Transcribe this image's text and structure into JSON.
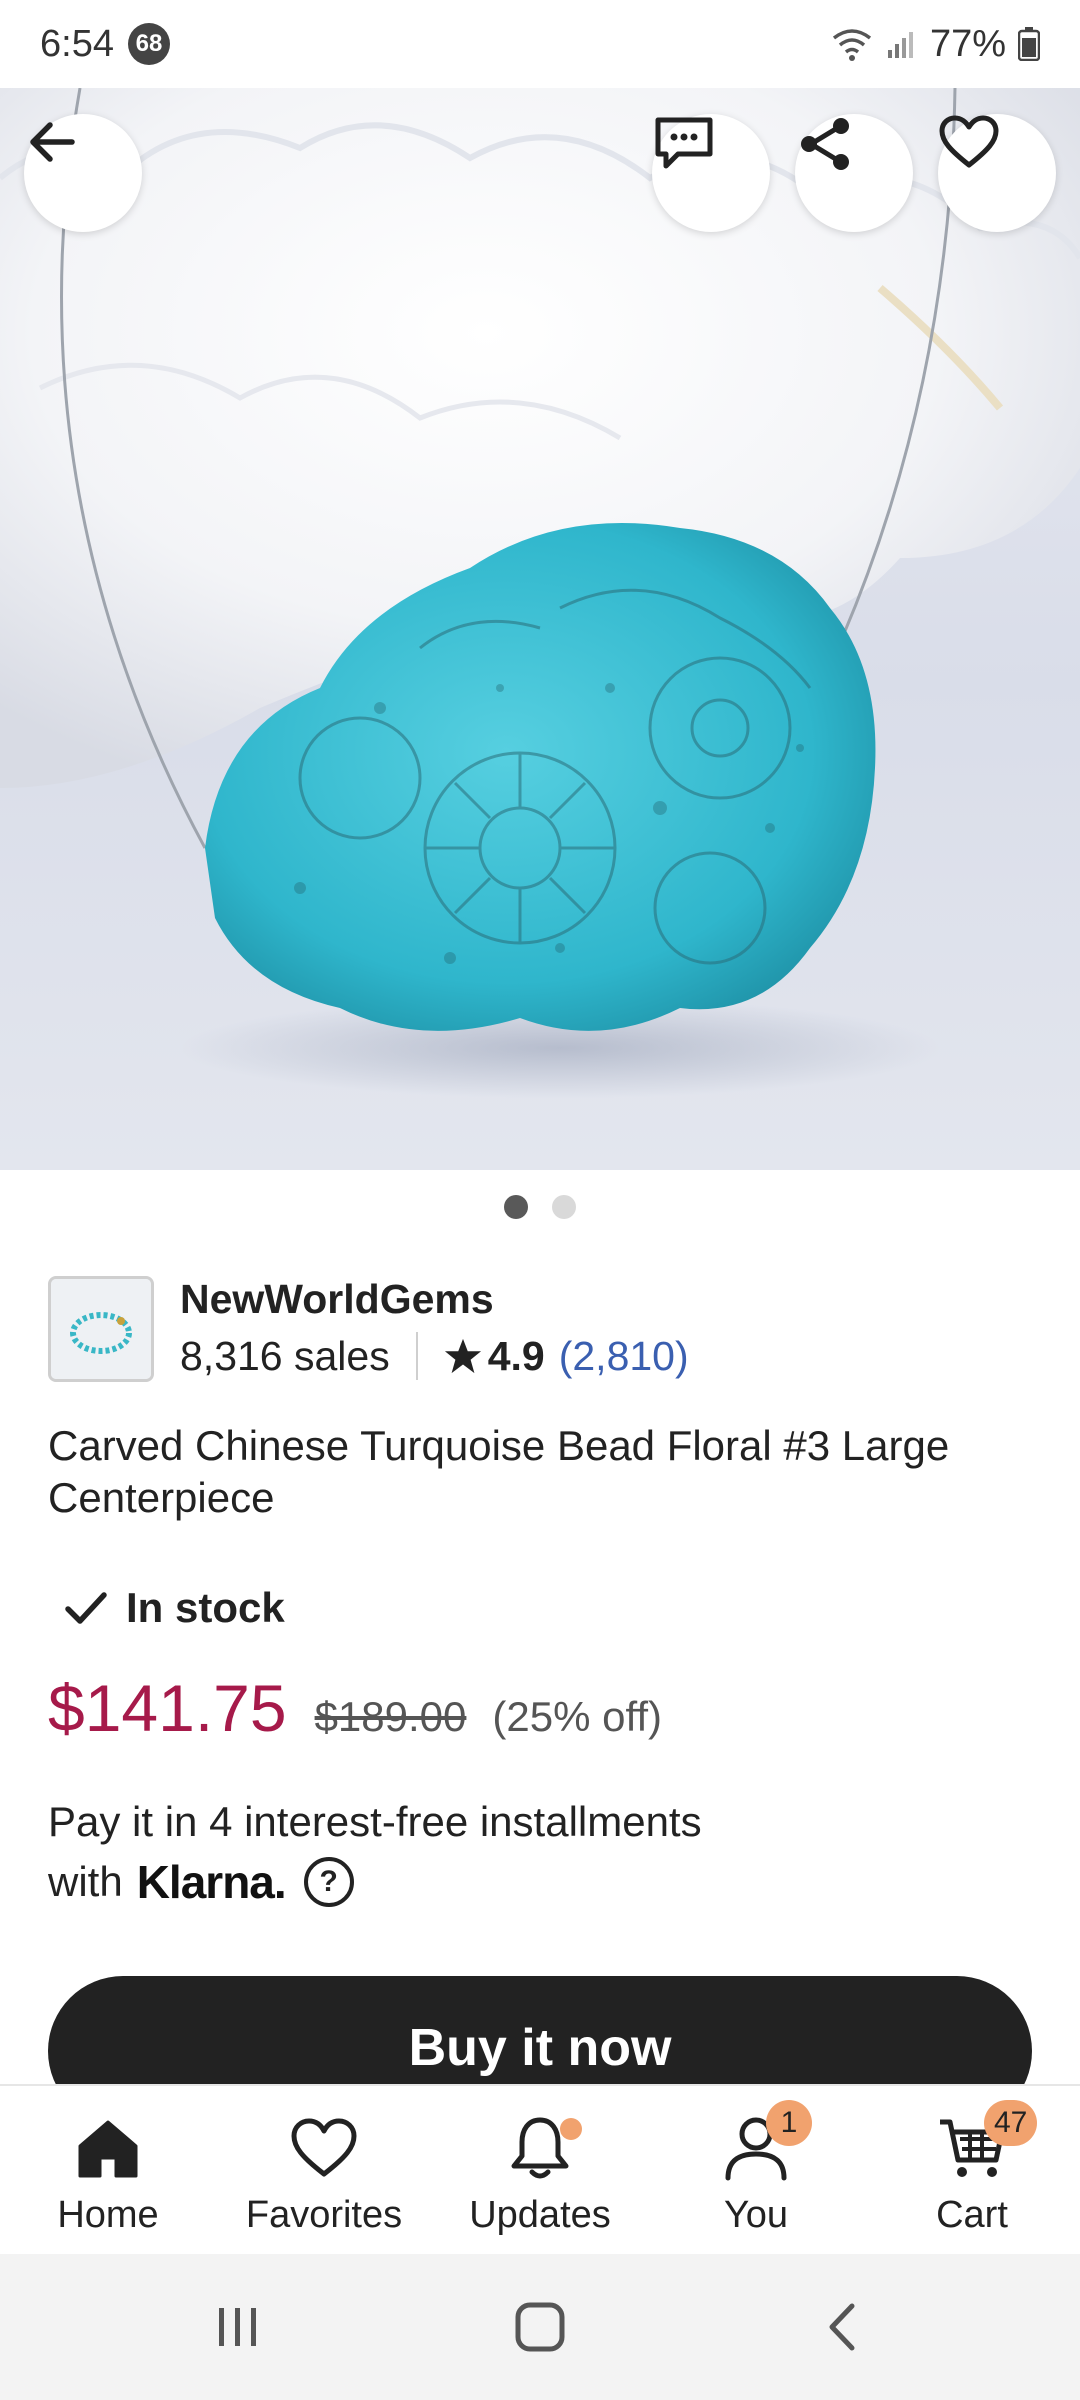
{
  "status_bar": {
    "time": "6:54",
    "notification_count": "68",
    "battery": "77%"
  },
  "hero": {
    "icons": [
      "back-arrow-icon",
      "message-icon",
      "share-icon",
      "heart-icon"
    ],
    "image_count": 2,
    "active_image_index": 0
  },
  "shop": {
    "name": "NewWorldGems",
    "sales": "8,316 sales",
    "rating": "4.9",
    "reviews": "(2,810)"
  },
  "product": {
    "title": "Carved Chinese Turquoise Bead Floral #3 Large Centerpiece",
    "stock": "In stock",
    "price": "$141.75",
    "original_price": "$189.00",
    "discount": "(25% off)"
  },
  "klarna": {
    "line1": "Pay it in 4 interest-free installments",
    "line2_prefix": "with",
    "brand": "Klarna.",
    "help": "?"
  },
  "buy_button": "Buy it now",
  "tabs": [
    {
      "label": "Home",
      "icon": "home-icon",
      "active": true
    },
    {
      "label": "Favorites",
      "icon": "heart-icon"
    },
    {
      "label": "Updates",
      "icon": "bell-icon",
      "has_dot": true
    },
    {
      "label": "You",
      "icon": "user-icon",
      "badge": "1"
    },
    {
      "label": "Cart",
      "icon": "cart-icon",
      "badge": "47"
    }
  ],
  "colors": {
    "price": "#a61a4a",
    "link": "#3a5fb0",
    "button": "#222222",
    "badge": "#f1a26e"
  }
}
